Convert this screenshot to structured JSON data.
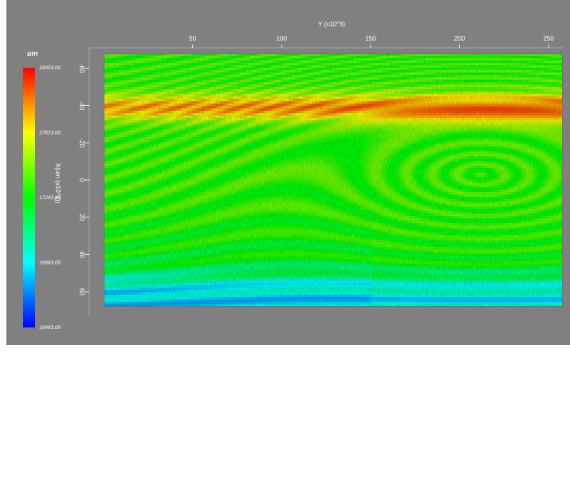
{
  "chart_data": {
    "type": "heatmap",
    "title": "",
    "xlabel": "Y (x10^3)",
    "ylabel": "X(um (x10^3))",
    "x_ticks": [
      50,
      100,
      150,
      200,
      250
    ],
    "y_ticks": [
      -60,
      -40,
      -20,
      0,
      20,
      40,
      60
    ],
    "xlim": [
      0,
      258
    ],
    "ylim": [
      -68,
      68
    ],
    "colorbar": {
      "unit": "um",
      "labels": [
        "18003.00",
        "17623.00",
        "17243.00",
        "16863.00",
        "16483.00"
      ],
      "min": 16483.0,
      "max": 18003.0,
      "colors": [
        "#ff0000",
        "#ffff00",
        "#00ff00",
        "#00ffff",
        "#0000ff"
      ]
    },
    "description_features": {
      "vortex_center": {
        "x": 212,
        "y": -3
      },
      "high_band_y": [
        -45,
        -33
      ],
      "low_region_y": [
        55,
        68
      ]
    }
  }
}
